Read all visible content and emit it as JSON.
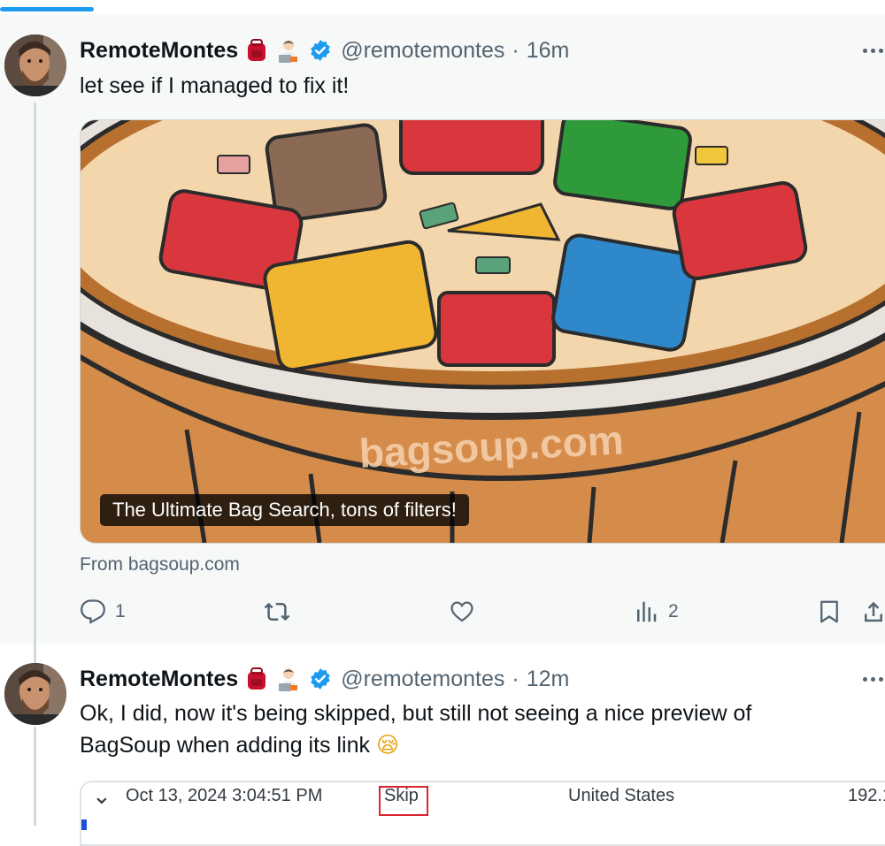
{
  "tweets": [
    {
      "display_name": "RemoteMontes",
      "badges": [
        "backpack-emoji",
        "technologist-emoji",
        "verified-badge"
      ],
      "handle": "@remotemontes",
      "separator": "·",
      "time": "16m",
      "text": "let see if I managed to fix it!",
      "card": {
        "image_watermark": "bagsoup.com",
        "caption": "The Ultimate Bag Search, tons of filters!",
        "source": "From bagsoup.com"
      },
      "actions": {
        "reply_count": "1",
        "retweet_count": "",
        "like_count": "",
        "views_count": "2"
      }
    },
    {
      "display_name": "RemoteMontes",
      "badges": [
        "backpack-emoji",
        "technologist-emoji",
        "verified-badge"
      ],
      "handle": "@remotemontes",
      "separator": "·",
      "time": "12m",
      "text_line1": "Ok, I did, now it's being skipped, but still not seeing a nice preview of",
      "text_line2": "BagSoup when adding its link",
      "text_emoji": "😪",
      "embedded_row": {
        "toggle": "⌄",
        "timestamp": "Oct 13, 2024 3:04:51 PM",
        "status": "Skip",
        "country": "United States",
        "ip_partial": "192.1"
      }
    }
  ],
  "colors": {
    "accent": "#1d9bf0",
    "verified": "#1d9bf0",
    "muted_text": "#536471",
    "highlight_box": "#d8262f"
  }
}
